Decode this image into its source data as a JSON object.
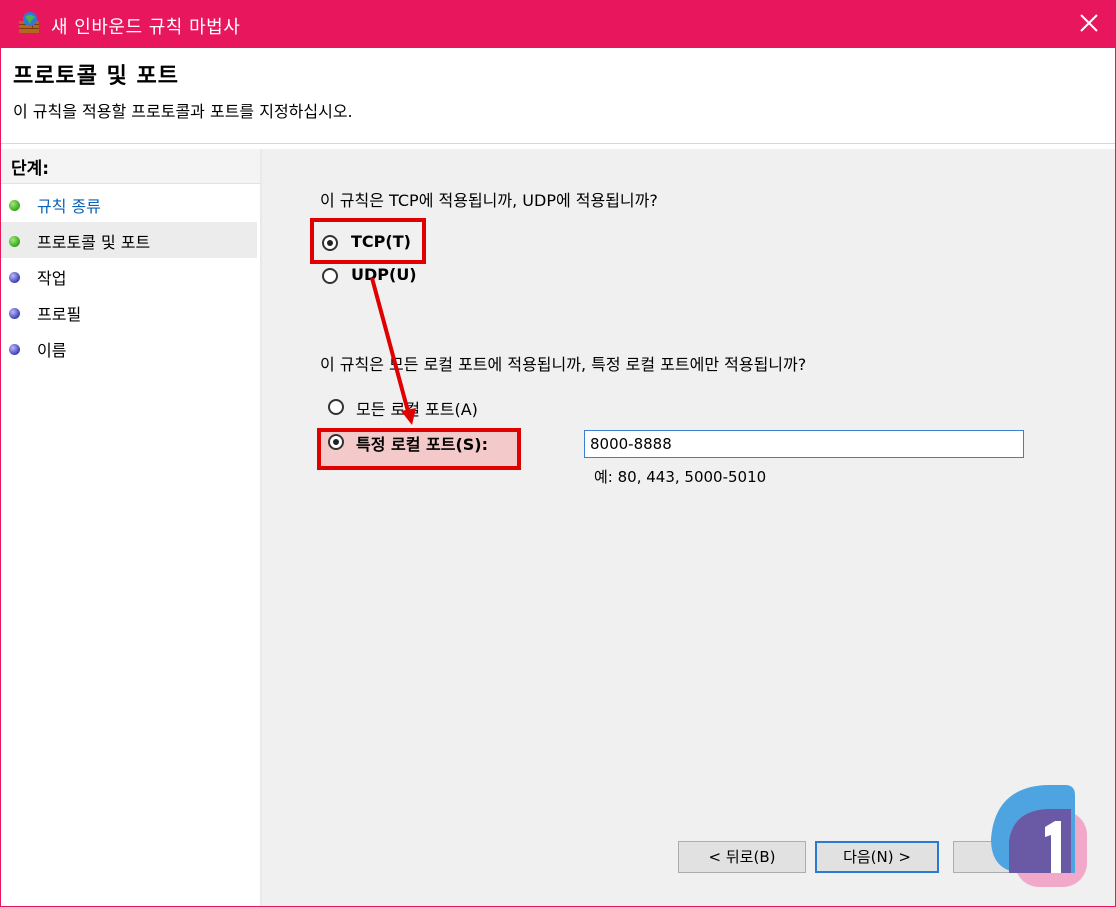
{
  "window": {
    "title": "새 인바운드 규칙 마법사",
    "title_bar_color": "#e8175d"
  },
  "header": {
    "title": "프로토콜 및 포트",
    "description": "이 규칙을 적용할 프로토콜과 포트를 지정하십시오."
  },
  "steps": {
    "heading": "단계:",
    "items": [
      {
        "label": "규칙 종류",
        "status": "completed",
        "color": "green"
      },
      {
        "label": "프로토콜 및 포트",
        "status": "current",
        "color": "green"
      },
      {
        "label": "작업",
        "status": "pending",
        "color": "blue"
      },
      {
        "label": "프로필",
        "status": "pending",
        "color": "blue"
      },
      {
        "label": "이름",
        "status": "pending",
        "color": "blue"
      }
    ]
  },
  "protocol": {
    "question": "이 규칙은 TCP에 적용됩니까, UDP에 적용됩니까?",
    "options": [
      {
        "label": "TCP(T)",
        "selected": true
      },
      {
        "label": "UDP(U)",
        "selected": false
      }
    ]
  },
  "ports": {
    "question": "이 규칙은 모든 로컬 포트에 적용됩니까, 특정 로컬 포트에만 적용됩니까?",
    "options": [
      {
        "label": "모든 로컬 포트(A)",
        "selected": false
      },
      {
        "label": "특정 로컬 포트(S):",
        "selected": true
      }
    ],
    "value": "8000-8888",
    "example": "예: 80, 443, 5000-5010"
  },
  "buttons": {
    "back": "< 뒤로(B)",
    "next": "다음(N) >"
  },
  "annotation": {
    "highlight_color": "#e00000"
  }
}
